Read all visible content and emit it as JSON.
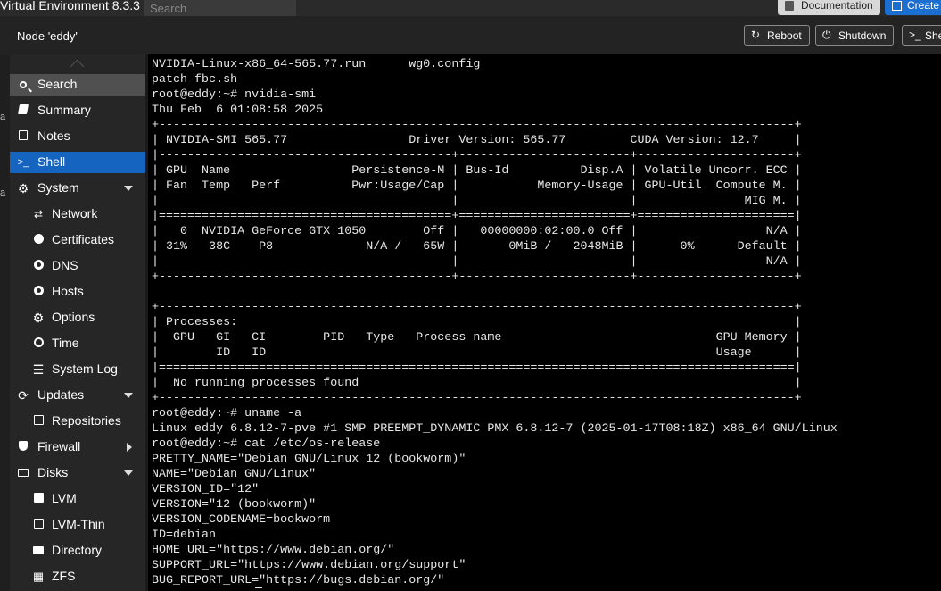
{
  "topbar": {
    "title": "Virtual Environment 8.3.3",
    "search_placeholder": "Search",
    "documentation_label": "Documentation",
    "create_label": "Create"
  },
  "nodebar": {
    "title": "Node 'eddy'",
    "reboot_label": "Reboot",
    "shutdown_label": "Shutdown",
    "shell_label": "She"
  },
  "leftstrip": {
    "fragments": [
      "a",
      "a"
    ]
  },
  "sidebar": {
    "items": [
      {
        "label": "Search",
        "icon": "search-icon"
      },
      {
        "label": "Summary",
        "icon": "book-icon"
      },
      {
        "label": "Notes",
        "icon": "notes-icon"
      },
      {
        "label": "Shell",
        "icon": "terminal-icon"
      },
      {
        "label": "System",
        "icon": "gear-icon"
      },
      {
        "label": "Network",
        "icon": "network-icon"
      },
      {
        "label": "Certificates",
        "icon": "certificate-icon"
      },
      {
        "label": "DNS",
        "icon": "globe-icon"
      },
      {
        "label": "Hosts",
        "icon": "globe-icon"
      },
      {
        "label": "Options",
        "icon": "gear-icon"
      },
      {
        "label": "Time",
        "icon": "clock-icon"
      },
      {
        "label": "System Log",
        "icon": "list-icon"
      },
      {
        "label": "Updates",
        "icon": "refresh-icon"
      },
      {
        "label": "Repositories",
        "icon": "package-icon"
      },
      {
        "label": "Firewall",
        "icon": "shield-icon"
      },
      {
        "label": "Disks",
        "icon": "hdd-icon"
      },
      {
        "label": "LVM",
        "icon": "square-icon"
      },
      {
        "label": "LVM-Thin",
        "icon": "square-outline-icon"
      },
      {
        "label": "Directory",
        "icon": "folder-icon"
      },
      {
        "label": "ZFS",
        "icon": "grid-icon"
      }
    ]
  },
  "terminal": {
    "lines": [
      "NVIDIA-Linux-x86_64-565.77.run      wg0.config",
      "patch-fbc.sh",
      "root@eddy:~# nvidia-smi",
      "Thu Feb  6 01:08:58 2025",
      "+-----------------------------------------------------------------------------------------+",
      "| NVIDIA-SMI 565.77                 Driver Version: 565.77         CUDA Version: 12.7     |",
      "|-----------------------------------------+------------------------+----------------------+",
      "| GPU  Name                 Persistence-M | Bus-Id          Disp.A | Volatile Uncorr. ECC |",
      "| Fan  Temp   Perf          Pwr:Usage/Cap |           Memory-Usage | GPU-Util  Compute M. |",
      "|                                         |                        |               MIG M. |",
      "|=========================================+========================+======================|",
      "|   0  NVIDIA GeForce GTX 1050        Off |   00000000:02:00.0 Off |                  N/A |",
      "| 31%   38C    P8             N/A /   65W |       0MiB /   2048MiB |      0%      Default |",
      "|                                         |                        |                  N/A |",
      "+-----------------------------------------+------------------------+----------------------+",
      "",
      "+-----------------------------------------------------------------------------------------+",
      "| Processes:                                                                              |",
      "|  GPU   GI   CI        PID   Type   Process name                              GPU Memory |",
      "|        ID   ID                                                               Usage      |",
      "|=========================================================================================|",
      "|  No running processes found                                                             |",
      "+-----------------------------------------------------------------------------------------+",
      "root@eddy:~# uname -a",
      "Linux eddy 6.8.12-7-pve #1 SMP PREEMPT_DYNAMIC PMX 6.8.12-7 (2025-01-17T08:18Z) x86_64 GNU/Linux",
      "root@eddy:~# cat /etc/os-release",
      "PRETTY_NAME=\"Debian GNU/Linux 12 (bookworm)\"",
      "NAME=\"Debian GNU/Linux\"",
      "VERSION_ID=\"12\"",
      "VERSION=\"12 (bookworm)\"",
      "VERSION_CODENAME=bookworm",
      "ID=debian",
      "HOME_URL=\"https://www.debian.org/\"",
      "SUPPORT_URL=\"https://www.debian.org/support\"",
      "BUG_REPORT_URL=\"https://bugs.debian.org/\""
    ]
  }
}
